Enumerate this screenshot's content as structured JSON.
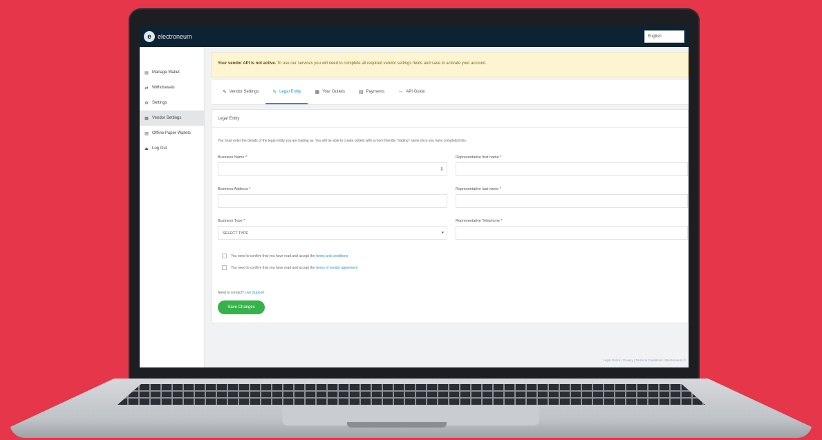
{
  "header": {
    "brand": "electroneum",
    "logo_letter": "e",
    "language": "English"
  },
  "sidebar": {
    "items": [
      {
        "icon": "▤",
        "label": "Manage Wallet"
      },
      {
        "icon": "⇄",
        "label": "Withdrawals"
      },
      {
        "icon": "⚙",
        "label": "Settings"
      },
      {
        "icon": "▦",
        "label": "Vendor Settings"
      },
      {
        "icon": "▥",
        "label": "Offline Paper Wallets"
      },
      {
        "icon": "⏏",
        "label": "Log Out"
      }
    ]
  },
  "alert": {
    "strong": "Your vendor API is not active.",
    "text": "To use our services you will need to complete all required vendor settings fields and save to activate your account."
  },
  "tabs": [
    {
      "icon": "✎",
      "label": "Vendor Settings"
    },
    {
      "icon": "✎",
      "label": "Legal Entity"
    },
    {
      "icon": "▦",
      "label": "Your Outlets"
    },
    {
      "icon": "▤",
      "label": "Payments"
    },
    {
      "icon": "↔",
      "label": "API Guide"
    }
  ],
  "panel": {
    "title": "Legal Entity",
    "intro": "You must enter the details of the legal entity you are trading as. You will be able to create outlets with a more friendly \"trading\" name once you have completed this.",
    "business_name_label": "Business Name *",
    "business_name_suffix": "⇕",
    "business_address_label": "Business Address *",
    "business_type_label": "Business Type *",
    "business_type_value": "SELECT TYPE",
    "rep_first_name_label": "Representative first name *",
    "rep_last_name_label": "Representative last name *",
    "rep_phone_label": "Representative Telephone *",
    "terms_text": "You need to confirm that you have read and accept the",
    "terms_link": "terms and conditions",
    "privacy_text": "You need to confirm that you have read and accept the",
    "privacy_link": "terms of vendor agreement",
    "help_text": "Need to contact?",
    "help_link": "Live Support",
    "save_label": "Save Changes"
  },
  "footer": "Legal Notice | Privacy | Terms & Conditions | Electroneum ©"
}
